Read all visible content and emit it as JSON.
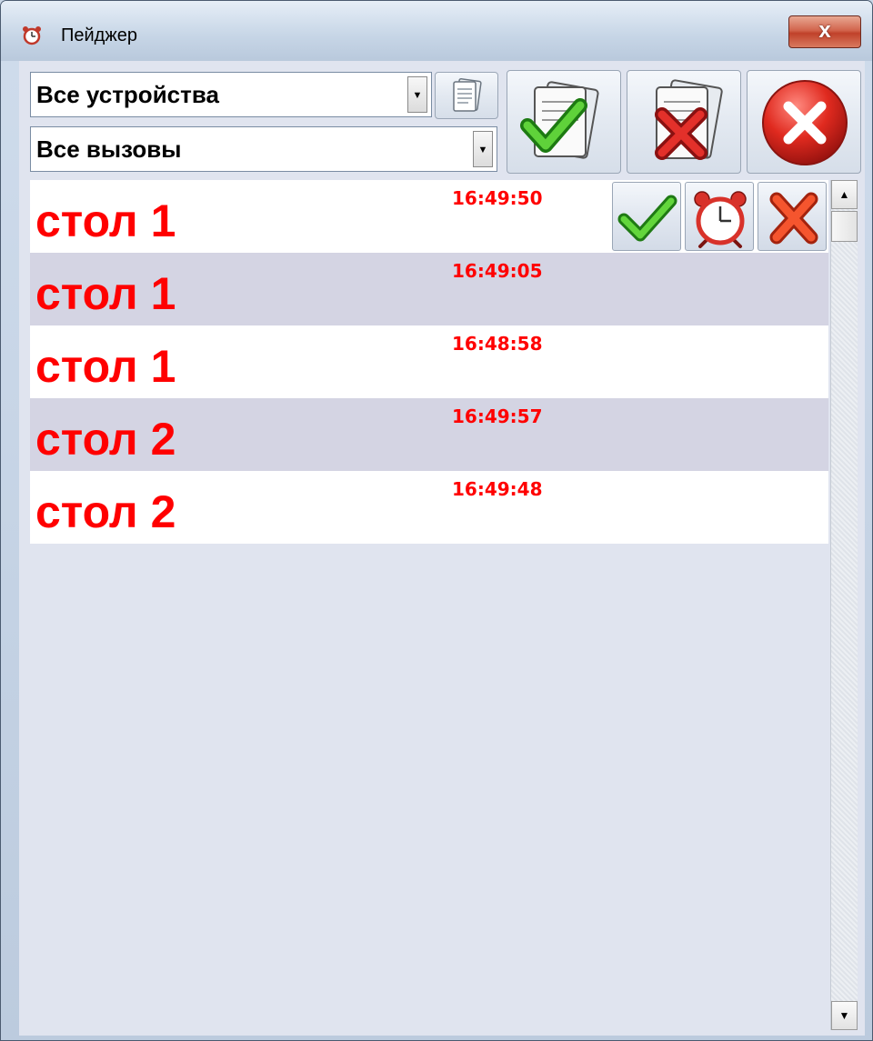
{
  "window": {
    "title": "Пейджер",
    "close_glyph": "x"
  },
  "filters": {
    "device_value": "Все устройства",
    "calls_value": "Все вызовы"
  },
  "toolbar": {
    "icons": [
      "notepad-icon",
      "accept-all-icon",
      "reject-all-icon",
      "exit-icon"
    ]
  },
  "calls": [
    {
      "name": "стол 1",
      "time": "16:49:50"
    },
    {
      "name": "стол 1",
      "time": "16:49:05"
    },
    {
      "name": "стол 1",
      "time": "16:48:58"
    },
    {
      "name": "стол 2",
      "time": "16:49:57"
    },
    {
      "name": "стол 2",
      "time": "16:49:48"
    }
  ],
  "row_actions": [
    "check-icon",
    "alarm-clock-icon",
    "cross-icon"
  ],
  "colors": {
    "call_text": "#ff0000",
    "row_alt": "#d4d4e3",
    "row": "#ffffff",
    "list_bg": "#e0e4ef"
  },
  "scrollbar": {
    "up_glyph": "▲",
    "down_glyph": "▼"
  }
}
